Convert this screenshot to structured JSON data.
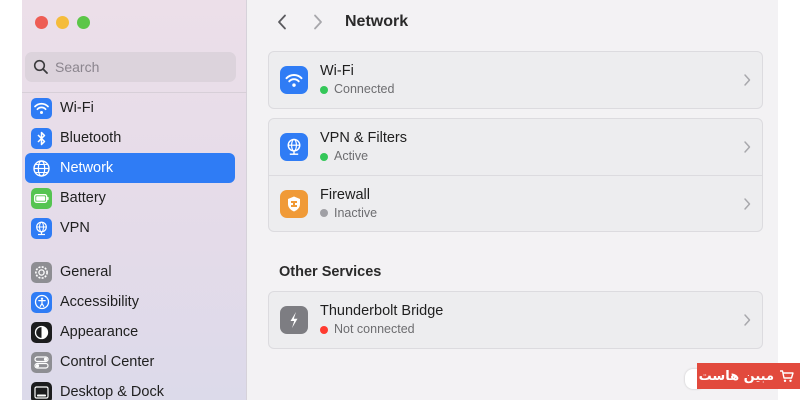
{
  "window": {
    "title": "Network",
    "controls": [
      "close",
      "minimize",
      "zoom"
    ]
  },
  "search": {
    "placeholder": "Search",
    "value": ""
  },
  "sidebar": {
    "items": [
      {
        "label": "Wi-Fi",
        "icon": "wifi-icon"
      },
      {
        "label": "Bluetooth",
        "icon": "bluetooth-icon"
      },
      {
        "label": "Network",
        "icon": "network-globe-icon",
        "selected": true
      },
      {
        "label": "Battery",
        "icon": "battery-icon"
      },
      {
        "label": "VPN",
        "icon": "vpn-globe-icon"
      },
      {
        "label": "General",
        "icon": "gear-icon"
      },
      {
        "label": "Accessibility",
        "icon": "accessibility-icon"
      },
      {
        "label": "Appearance",
        "icon": "appearance-icon"
      },
      {
        "label": "Control Center",
        "icon": "control-center-icon"
      },
      {
        "label": "Desktop & Dock",
        "icon": "desktop-dock-icon"
      }
    ]
  },
  "main": {
    "title": "Network",
    "groups": [
      {
        "rows": [
          {
            "title": "Wi-Fi",
            "status": "Connected",
            "status_color": "#34c759",
            "icon": "wifi-icon"
          }
        ]
      },
      {
        "rows": [
          {
            "title": "VPN & Filters",
            "status": "Active",
            "status_color": "#34c759",
            "icon": "vpn-globe-icon"
          },
          {
            "title": "Firewall",
            "status": "Inactive",
            "status_color": "#a0a0a5",
            "icon": "firewall-shield-icon"
          }
        ]
      }
    ],
    "other_services": {
      "title": "Other Services",
      "rows": [
        {
          "title": "Thunderbolt Bridge",
          "status": "Not connected",
          "status_color": "#ff3b30",
          "icon": "thunderbolt-icon"
        }
      ]
    }
  },
  "watermark": {
    "text": "مبین هاست"
  },
  "colors": {
    "accent": "#2f7cf5",
    "sidebar_bg": "#e8dde9",
    "content_bg": "#f3f2f4"
  }
}
